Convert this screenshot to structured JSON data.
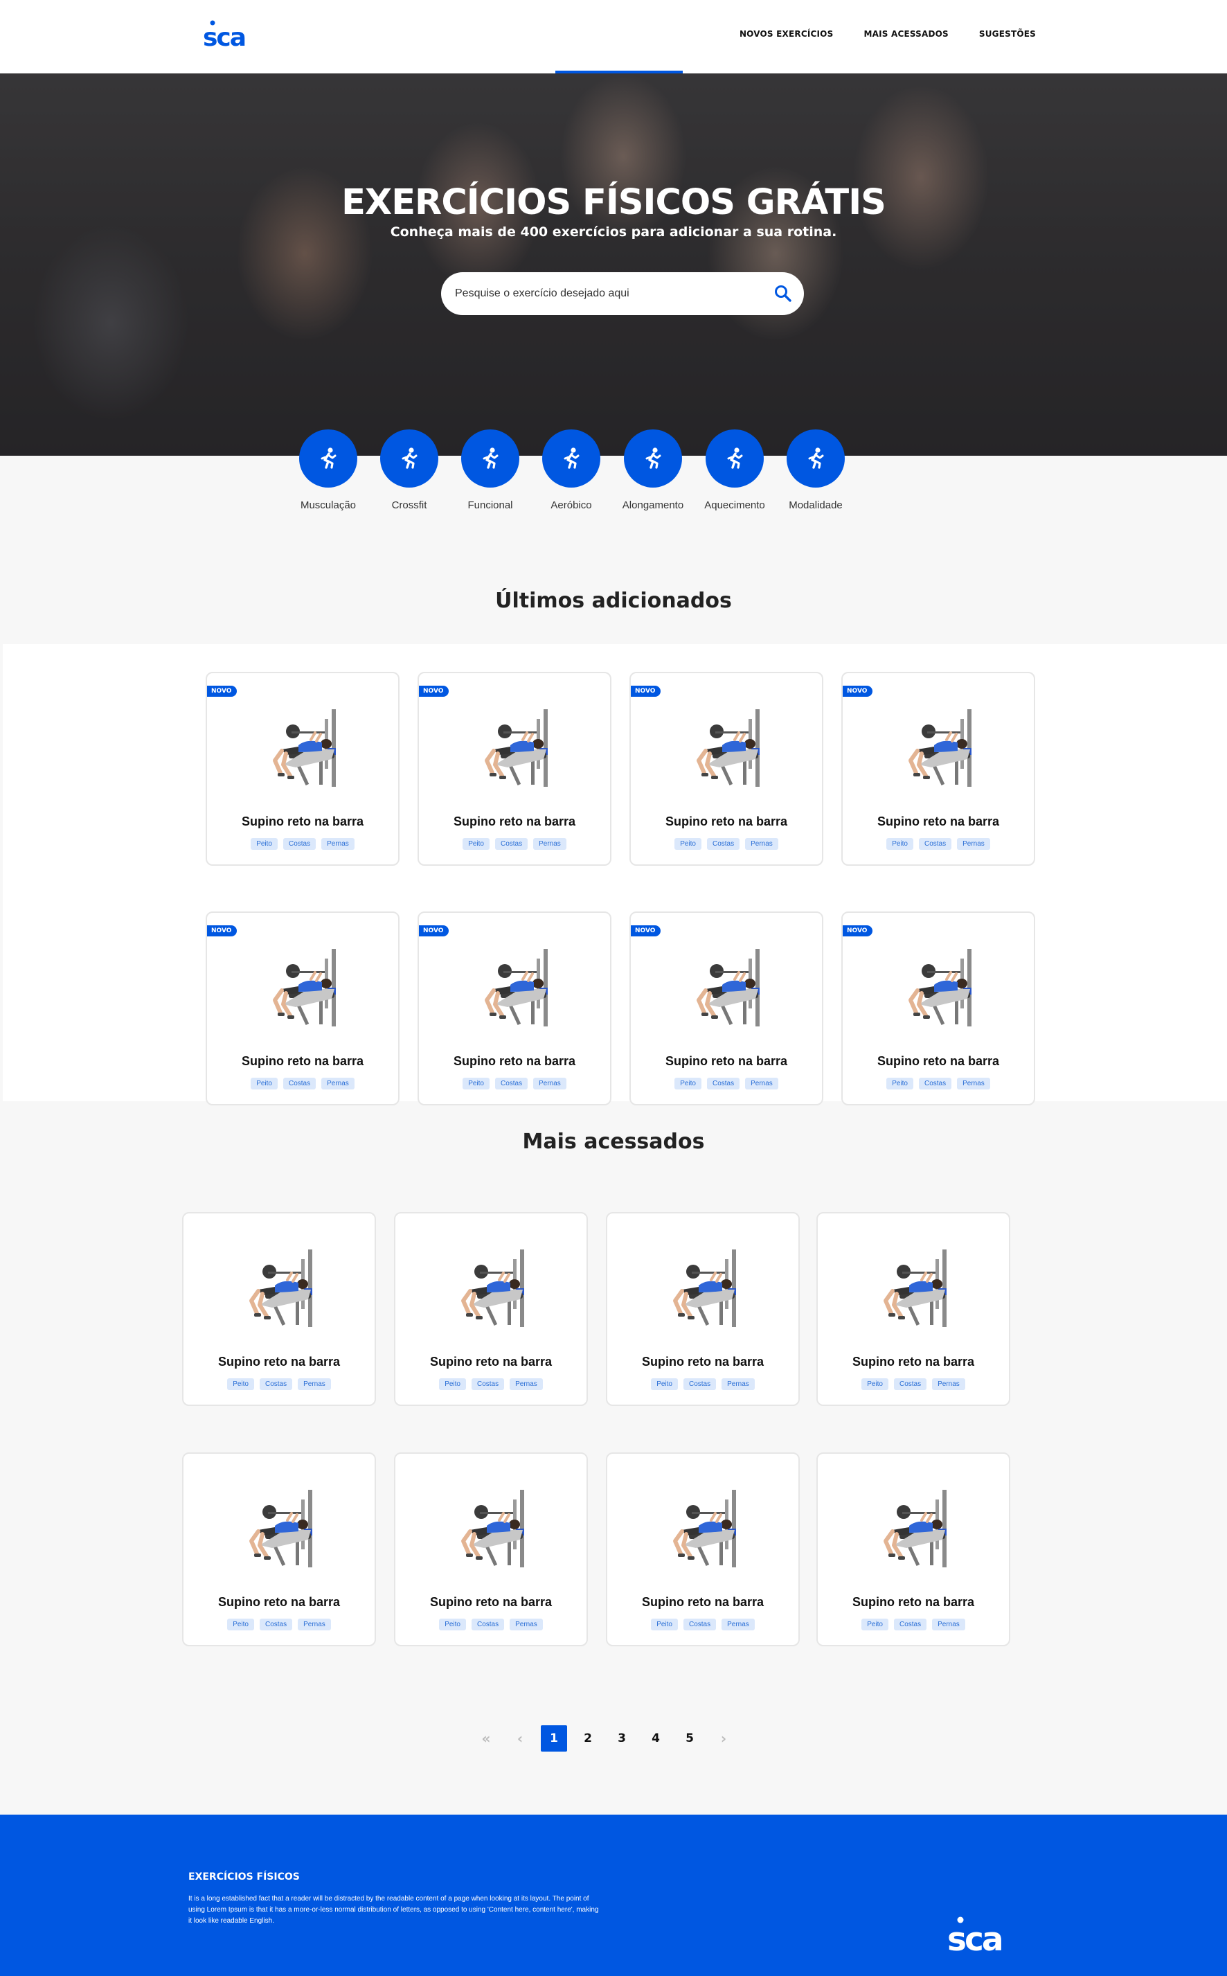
{
  "header": {
    "logo_text": "sca",
    "nav": [
      "NOVOS EXERCÍCIOS",
      "MAIS ACESSADOS",
      "SUGESTÕES"
    ]
  },
  "hero": {
    "title": "EXERCÍCIOS FÍSICOS GRÁTIS",
    "subtitle": "Conheça mais de 400 exercícios para adicionar a sua rotina.",
    "search_placeholder": "Pesquise o exercício desejado aqui"
  },
  "categories": [
    "Musculação",
    "Crossfit",
    "Funcional",
    "Aeróbico",
    "Alongamento",
    "Aquecimento",
    "Modalidade"
  ],
  "latest": {
    "title": "Últimos adicionados",
    "badge": "NOVO",
    "cards": [
      {
        "title": "Supino reto na barra",
        "tags": [
          "Peito",
          "Costas",
          "Pernas"
        ]
      },
      {
        "title": "Supino reto na barra",
        "tags": [
          "Peito",
          "Costas",
          "Pernas"
        ]
      },
      {
        "title": "Supino reto na barra",
        "tags": [
          "Peito",
          "Costas",
          "Pernas"
        ]
      },
      {
        "title": "Supino reto na barra",
        "tags": [
          "Peito",
          "Costas",
          "Pernas"
        ]
      },
      {
        "title": "Supino reto na barra",
        "tags": [
          "Peito",
          "Costas",
          "Pernas"
        ]
      },
      {
        "title": "Supino reto na barra",
        "tags": [
          "Peito",
          "Costas",
          "Pernas"
        ]
      },
      {
        "title": "Supino reto na barra",
        "tags": [
          "Peito",
          "Costas",
          "Pernas"
        ]
      },
      {
        "title": "Supino reto na barra",
        "tags": [
          "Peito",
          "Costas",
          "Pernas"
        ]
      }
    ]
  },
  "popular": {
    "title": "Mais acessados",
    "cards": [
      {
        "title": "Supino reto na barra",
        "tags": [
          "Peito",
          "Costas",
          "Pernas"
        ]
      },
      {
        "title": "Supino reto na barra",
        "tags": [
          "Peito",
          "Costas",
          "Pernas"
        ]
      },
      {
        "title": "Supino reto na barra",
        "tags": [
          "Peito",
          "Costas",
          "Pernas"
        ]
      },
      {
        "title": "Supino reto na barra",
        "tags": [
          "Peito",
          "Costas",
          "Pernas"
        ]
      },
      {
        "title": "Supino reto na barra",
        "tags": [
          "Peito",
          "Costas",
          "Pernas"
        ]
      },
      {
        "title": "Supino reto na barra",
        "tags": [
          "Peito",
          "Costas",
          "Pernas"
        ]
      },
      {
        "title": "Supino reto na barra",
        "tags": [
          "Peito",
          "Costas",
          "Pernas"
        ]
      },
      {
        "title": "Supino reto na barra",
        "tags": [
          "Peito",
          "Costas",
          "Pernas"
        ]
      }
    ]
  },
  "pagination": {
    "first_icon": "double-chevron-left-icon",
    "prev_icon": "chevron-left-icon",
    "pages": [
      "1",
      "2",
      "3",
      "4",
      "5"
    ],
    "current": "1",
    "next_icon": "chevron-right-icon"
  },
  "footer": {
    "title": "EXERCÍCIOS FÍSICOS",
    "text": "It is a long established fact that a reader will be distracted by the readable content of a page when looking at its layout. The point of using Lorem Ipsum is that it has a more-or-less normal distribution of letters, as opposed to using 'Content here, content here', making it look like readable English.",
    "logo_text": "sca"
  },
  "colors": {
    "brand": "#0057e1",
    "tag_bg": "#dbe8fb"
  }
}
